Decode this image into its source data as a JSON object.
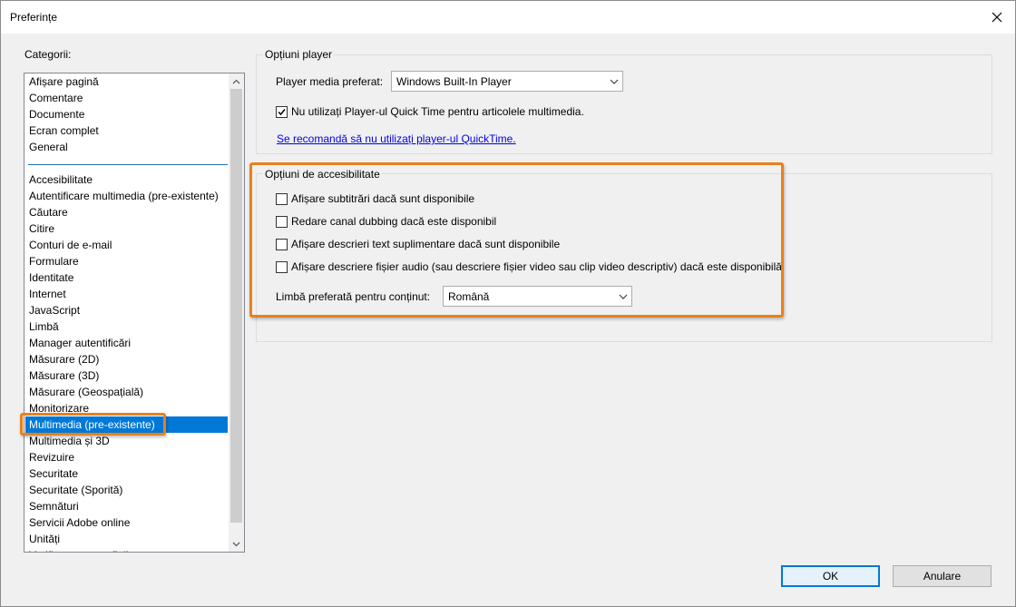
{
  "window": {
    "title": "Preferințe"
  },
  "categories": {
    "label": "Categorii:",
    "top_items": [
      "Afișare pagină",
      "Comentare",
      "Documente",
      "Ecran complet",
      "General"
    ],
    "items": [
      "Accesibilitate",
      "Autentificare multimedia (pre-existente)",
      "Căutare",
      "Citire",
      "Conturi de e-mail",
      "Formulare",
      "Identitate",
      "Internet",
      "JavaScript",
      "Limbă",
      "Manager autentificări",
      "Măsurare (2D)",
      "Măsurare (3D)",
      "Măsurare (Geospațială)",
      "Monitorizare",
      "Multimedia (pre-existente)",
      "Multimedia și 3D",
      "Revizuire",
      "Securitate",
      "Securitate (Sporită)",
      "Semnături",
      "Servicii Adobe online",
      "Unități",
      "Verificare ortografică"
    ],
    "selected": "Multimedia (pre-existente)"
  },
  "player_options": {
    "title": "Opțiuni player",
    "media_player_label": "Player media preferat:",
    "media_player_value": "Windows Built-In Player",
    "quicktime_checkbox_label": "Nu utilizați Player-ul Quick Time pentru articolele multimedia.",
    "quicktime_checked": true,
    "quicktime_link": "Se recomandă să nu utilizați player-ul QuickTime."
  },
  "accessibility_options": {
    "title": "Opțiuni de accesibilitate",
    "checkboxes": [
      "Afișare subtitrări dacă sunt disponibile",
      "Redare canal dubbing dacă este disponibil",
      "Afișare descrieri text suplimentare dacă sunt disponibile",
      "Afișare descriere fișier audio (sau descriere fișier video sau clip video descriptiv) dacă este disponibilă"
    ],
    "language_label": "Limbă preferată pentru conținut:",
    "language_value": "Română"
  },
  "buttons": {
    "ok": "OK",
    "cancel": "Anulare"
  },
  "colors": {
    "highlight": "#e8801c",
    "selection": "#0078d7",
    "link": "#0000ee"
  }
}
